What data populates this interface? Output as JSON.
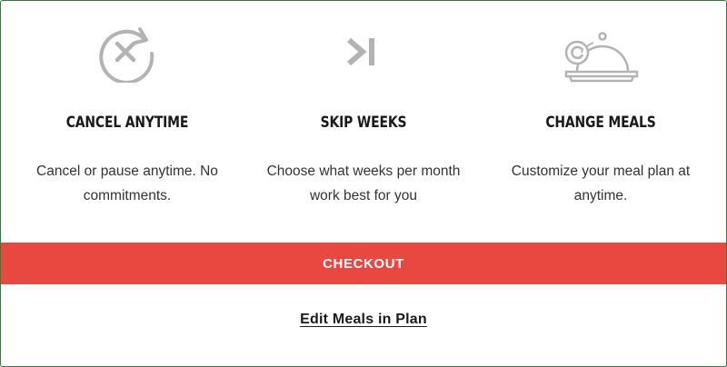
{
  "features": [
    {
      "icon": "cancel-cycle-icon",
      "title": "CANCEL ANYTIME",
      "description": "Cancel or pause anytime. No commitments."
    },
    {
      "icon": "skip-forward-icon",
      "title": "SKIP WEEKS",
      "description": "Choose what weeks per month work best for you"
    },
    {
      "icon": "meal-cloche-icon",
      "title": "CHANGE MEALS",
      "description": "Customize your meal plan at anytime."
    }
  ],
  "checkout": {
    "label": "CHECKOUT",
    "color": "#e8483f"
  },
  "edit_link": {
    "label": "Edit Meals in Plan"
  },
  "colors": {
    "icon_gray": "#b3b3b3",
    "text_dark": "#1a1a1a",
    "border_green": "#2f7d3c"
  }
}
